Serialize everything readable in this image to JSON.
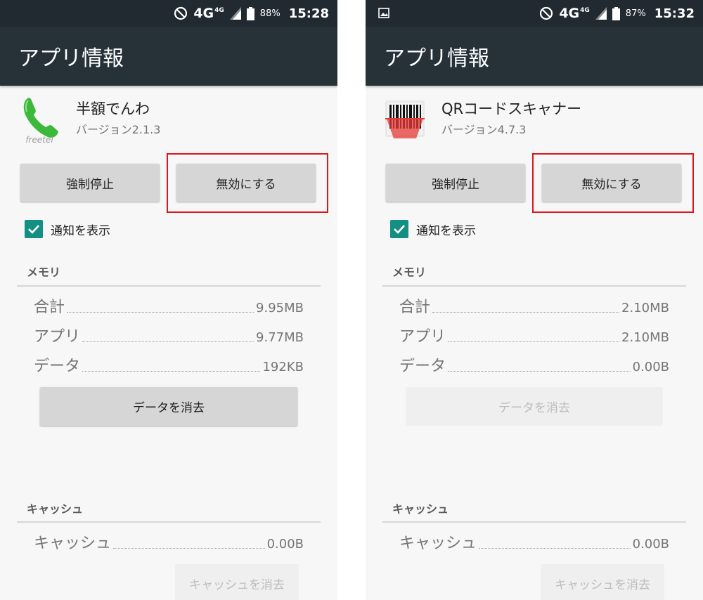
{
  "screens": [
    {
      "status_bar": {
        "network": "4G",
        "network_sup": "4G",
        "battery": "88%",
        "time": "15:28",
        "has_gallery_icon": false
      },
      "app_bar_title": "アプリ情報",
      "app": {
        "name": "半額でんわ",
        "version": "バージョン2.1.3",
        "icon": "phone-icon"
      },
      "buttons": {
        "force_stop": "強制停止",
        "disable": "無効にする"
      },
      "notification": {
        "label": "通知を表示",
        "checked": true
      },
      "memory": {
        "header": "メモリ",
        "rows": [
          {
            "label": "合計",
            "value": "9.95MB"
          },
          {
            "label": "アプリ",
            "value": "9.77MB"
          },
          {
            "label": "データ",
            "value": "192KB"
          }
        ],
        "clear_data": "データを消去",
        "clear_data_enabled": true
      },
      "cache": {
        "header": "キャッシュ",
        "rows": [
          {
            "label": "キャッシュ",
            "value": "0.00B"
          }
        ],
        "clear_cache": "キャッシュを消去",
        "clear_cache_enabled": false
      }
    },
    {
      "status_bar": {
        "network": "4G",
        "network_sup": "4G",
        "battery": "87%",
        "time": "15:32",
        "has_gallery_icon": true
      },
      "app_bar_title": "アプリ情報",
      "app": {
        "name": "QRコードスキャナー",
        "version": "バージョン4.7.3",
        "icon": "barcode-icon"
      },
      "buttons": {
        "force_stop": "強制停止",
        "disable": "無効にする"
      },
      "notification": {
        "label": "通知を表示",
        "checked": true
      },
      "memory": {
        "header": "メモリ",
        "rows": [
          {
            "label": "合計",
            "value": "2.10MB"
          },
          {
            "label": "アプリ",
            "value": "2.10MB"
          },
          {
            "label": "データ",
            "value": "0.00B"
          }
        ],
        "clear_data": "データを消去",
        "clear_data_enabled": false
      },
      "cache": {
        "header": "キャッシュ",
        "rows": [
          {
            "label": "キャッシュ",
            "value": "0.00B"
          }
        ],
        "clear_cache": "キャッシュを消去",
        "clear_cache_enabled": false
      }
    }
  ],
  "highlight_color": "#e0141b",
  "accent_color": "#148f84"
}
